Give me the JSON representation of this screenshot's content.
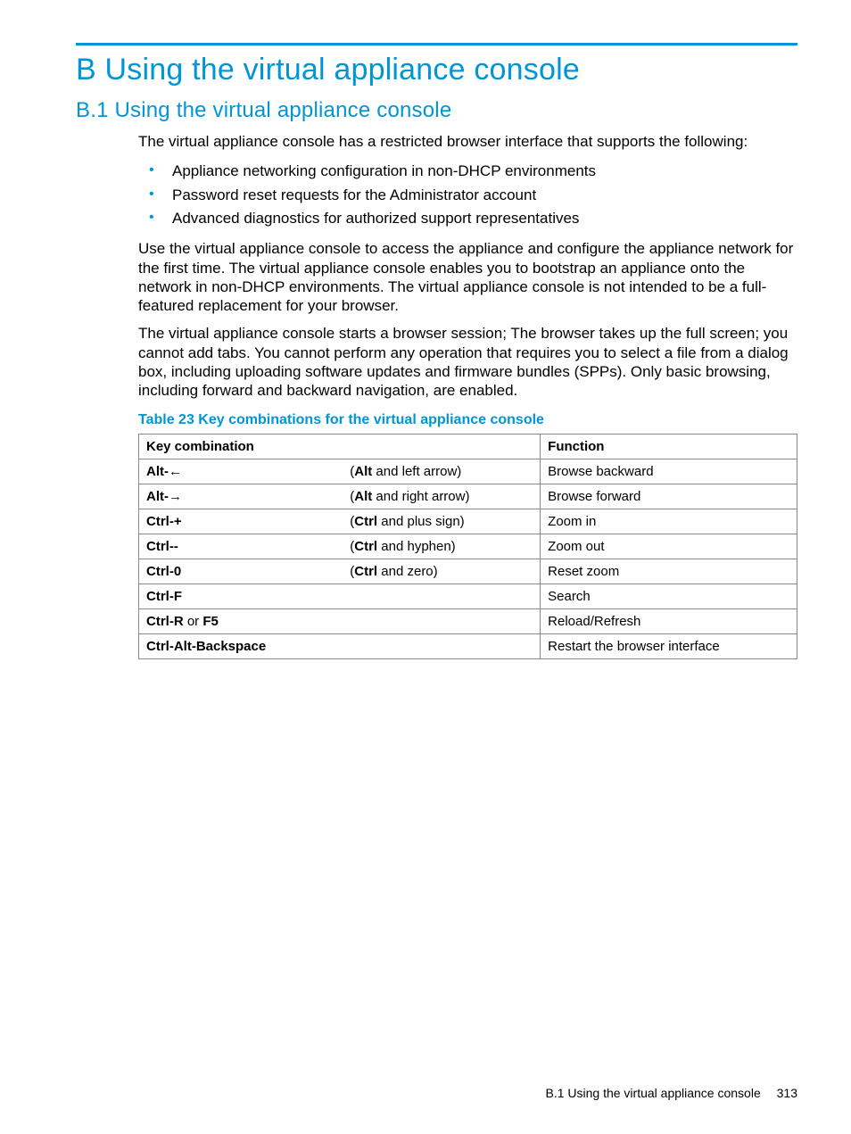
{
  "appendix_title": "B Using the virtual appliance console",
  "section_title": "B.1 Using the virtual appliance console",
  "intro": "The virtual appliance console has a restricted browser interface that supports the following:",
  "bullets": [
    "Appliance networking configuration in non-DHCP environments",
    "Password reset requests for the Administrator account",
    "Advanced diagnostics for authorized support representatives"
  ],
  "para2": "Use the virtual appliance console to access the appliance and configure the appliance network for the first time. The virtual appliance console enables you to bootstrap an appliance onto the network in non-DHCP environments. The virtual appliance console is not intended to be a full-featured replacement for your browser.",
  "para3": "The virtual appliance console starts a browser session; The browser takes up the full screen; you cannot add tabs. You cannot perform any operation that requires you to select a file from a dialog box, including uploading software updates and firmware bundles (SPPs). Only basic browsing, including forward and backward navigation, are enabled.",
  "table_caption": "Table 23 Key combinations for the virtual appliance console",
  "table": {
    "head_key": "Key combination",
    "head_fn": "Function",
    "rows": [
      {
        "key_html": "<span class='kw'>Alt-</span>←",
        "paren_html": "(<span class='kw'>Alt</span> and left arrow)",
        "fn": "Browse backward"
      },
      {
        "key_html": "<span class='kw'>Alt-</span>→",
        "paren_html": "(<span class='kw'>Alt</span> and right arrow)",
        "fn": "Browse forward"
      },
      {
        "key_html": "<span class='kw'>Ctrl-+</span>",
        "paren_html": "(<span class='kw'>Ctrl</span> and plus sign)",
        "fn": "Zoom in"
      },
      {
        "key_html": "<span class='kw'>Ctrl--</span>",
        "paren_html": "(<span class='kw'>Ctrl</span> and hyphen)",
        "fn": "Zoom out"
      },
      {
        "key_html": "<span class='kw'>Ctrl-0</span>",
        "paren_html": "(<span class='kw'>Ctrl</span> and zero)",
        "fn": "Reset zoom"
      },
      {
        "key_html": "<span class='kw'>Ctrl-F</span>",
        "paren_html": "",
        "fn": "Search"
      },
      {
        "key_html": "<span class='kw'>Ctrl-R</span> <span class='norm'>or</span> <span class='kw'>F5</span>",
        "paren_html": "",
        "fn": "Reload/Refresh"
      },
      {
        "key_html": "<span class='kw'>Ctrl-Alt-Backspace</span>",
        "paren_html": "",
        "fn": "Restart the browser interface"
      }
    ]
  },
  "footer_text": "B.1 Using the virtual appliance console",
  "page_number": "313"
}
